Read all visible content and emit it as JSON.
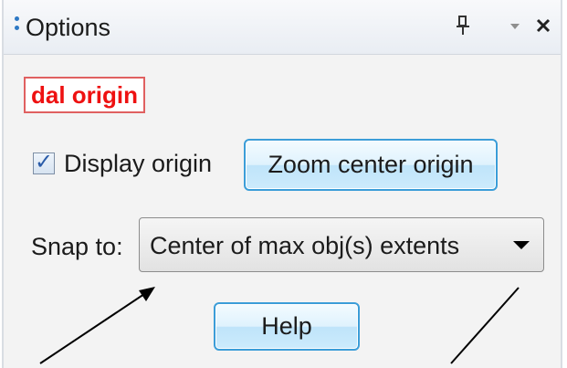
{
  "panel": {
    "title": "Options",
    "pin_glyph": "ꟷ",
    "menu_glyph": "▼",
    "close_glyph": "✕"
  },
  "annotation_label": "dal origin",
  "display_origin": {
    "label": "Display origin",
    "checked": true
  },
  "zoom_button_label": "Zoom center origin",
  "snap": {
    "label": "Snap to:",
    "selected": "Center of max obj(s) extents"
  },
  "help_button_label": "Help",
  "icons": {
    "grip": "grip-dots-icon",
    "pin": "pin-icon",
    "menu": "dropdown-menu-icon",
    "close": "close-icon",
    "check": "checkmark-icon",
    "select_arrow": "chevron-down-icon"
  },
  "colors": {
    "accent_border": "#3b9dd8",
    "annotation_text": "#ee1111",
    "annotation_border": "#e06060",
    "title_grip": "#2d78c4"
  }
}
